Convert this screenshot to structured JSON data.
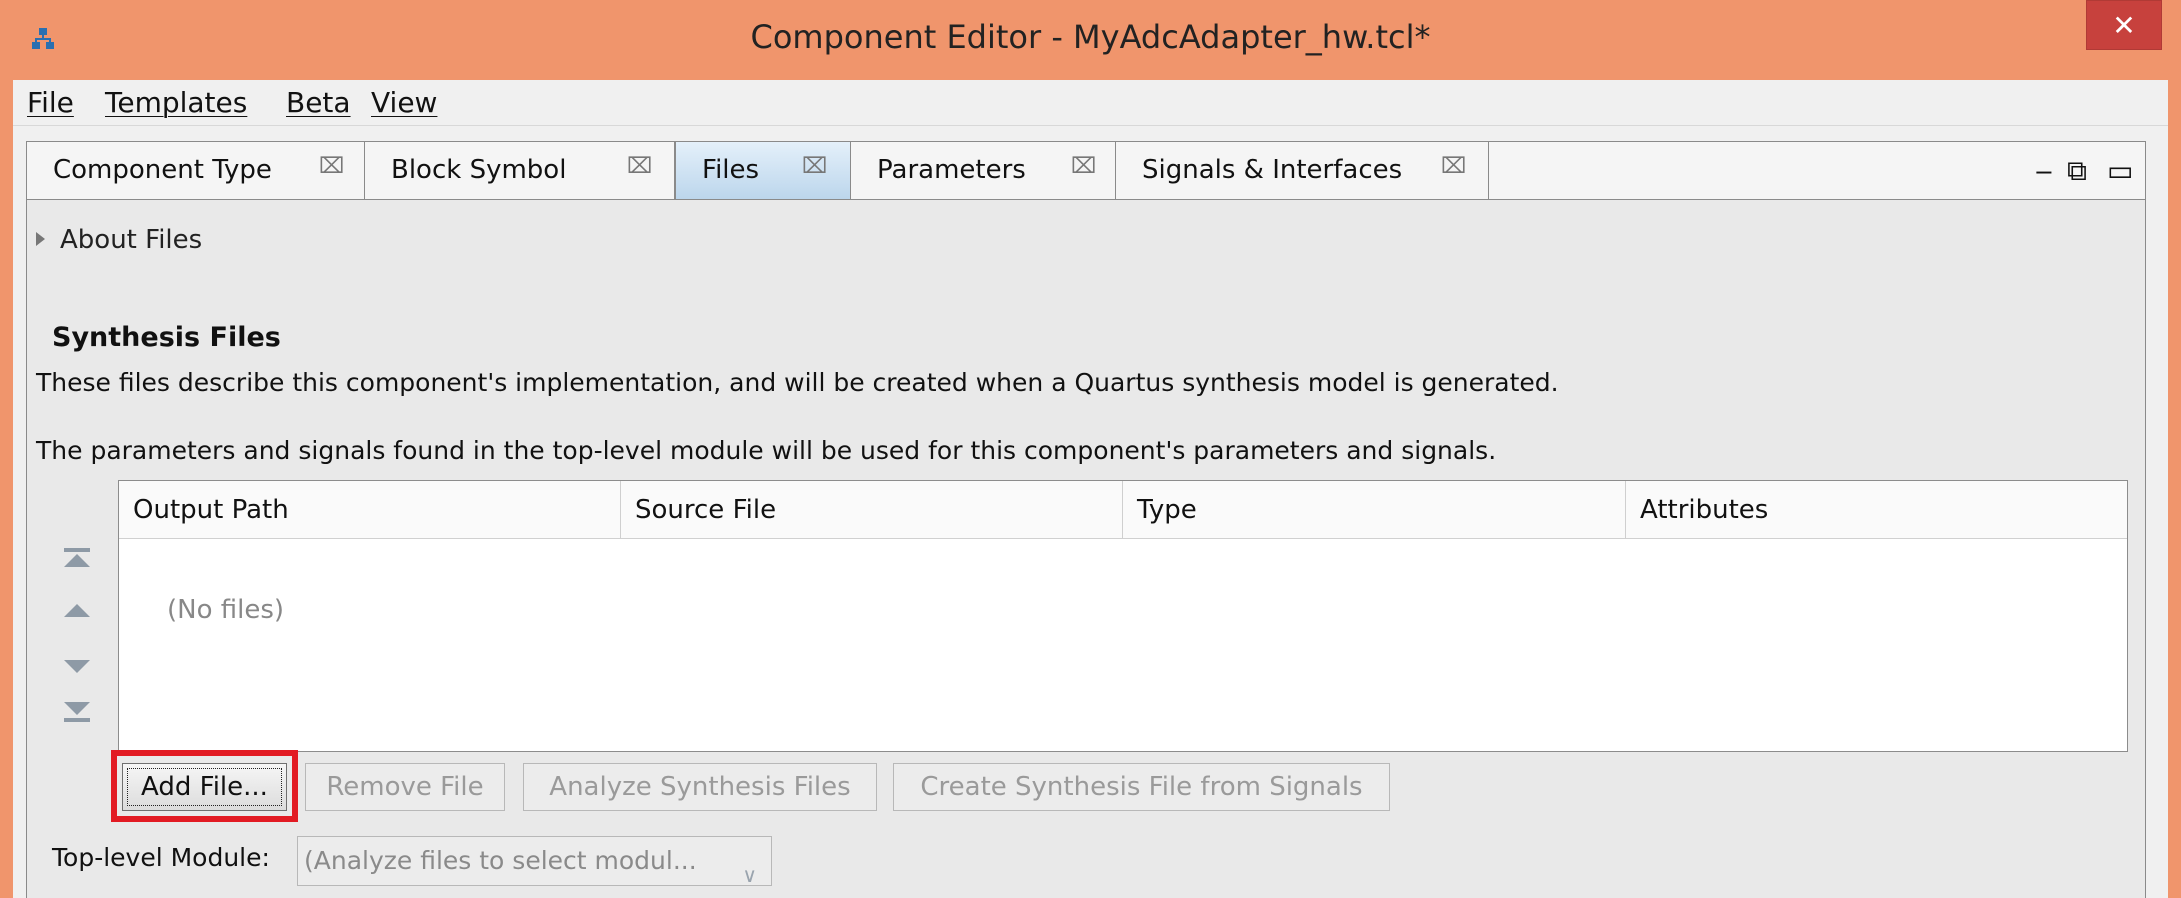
{
  "window": {
    "title": "Component Editor - MyAdcAdapter_hw.tcl*",
    "close_glyph": "✕"
  },
  "menubar": {
    "items": [
      "File",
      "Templates",
      "Beta",
      "View"
    ]
  },
  "tabs": [
    {
      "label": "Component Type",
      "active": false
    },
    {
      "label": "Block Symbol",
      "active": false
    },
    {
      "label": "Files",
      "active": true
    },
    {
      "label": "Parameters",
      "active": false
    },
    {
      "label": "Signals & Interfaces",
      "active": false
    }
  ],
  "tab_close_glyph": "⌧",
  "panel_controls": {
    "minimize_glyph": "‒",
    "restore_glyph": "⧉",
    "maximize_glyph": "▭"
  },
  "about": {
    "label": "About Files"
  },
  "synthesis": {
    "title": "Synthesis Files",
    "description": "These files describe this component's implementation, and will be created when a Quartus synthesis model is generated.",
    "note": "The parameters and signals found in the top-level module will be used for this component's parameters and signals."
  },
  "table": {
    "columns": [
      "Output Path",
      "Source File",
      "Type",
      "Attributes"
    ],
    "empty_text": "(No files)"
  },
  "buttons": {
    "add_file": "Add File...",
    "remove_file": "Remove File",
    "analyze": "Analyze Synthesis Files",
    "create": "Create Synthesis File from Signals"
  },
  "top_level": {
    "label": "Top-level Module:",
    "value": "(Analyze files to select modul...",
    "arrow_glyph": "∨"
  },
  "colors": {
    "title_bar": "#f0956c",
    "close_button": "#c7413d",
    "highlight": "#e21b23",
    "active_tab": "#bcd6ec"
  }
}
